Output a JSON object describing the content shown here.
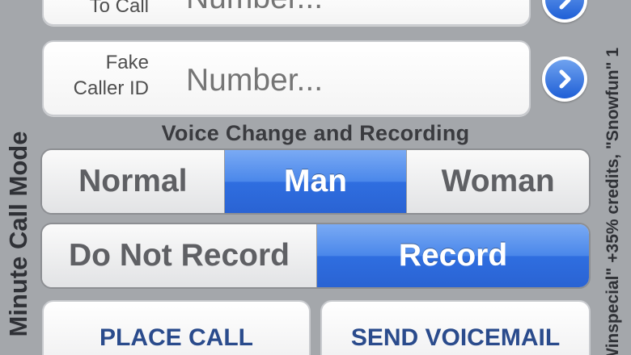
{
  "side_left_text": "Minute Call Mode",
  "side_right_text": "\"Winspecial\" +35% credits, \"Snowfun\" 1",
  "to_call": {
    "label": "To Call",
    "placeholder": "Number..."
  },
  "fake_caller": {
    "label_line1": "Fake",
    "label_line2": "Caller ID",
    "placeholder": "Number..."
  },
  "voice_section_title": "Voice Change and Recording",
  "voice_options": [
    {
      "label": "Normal",
      "selected": false
    },
    {
      "label": "Man",
      "selected": true
    },
    {
      "label": "Woman",
      "selected": false
    }
  ],
  "record_options": [
    {
      "label": "Do Not Record",
      "selected": false
    },
    {
      "label": "Record",
      "selected": true
    }
  ],
  "actions": {
    "place_call": "PLACE CALL",
    "send_voicemail": "SEND VOICEMAIL"
  },
  "colors": {
    "background": "#a4a7ab",
    "selected_segment": "#3a7ae6",
    "action_text": "#2a4b8c"
  },
  "icons": {
    "disclosure": "chevron-right-icon"
  }
}
